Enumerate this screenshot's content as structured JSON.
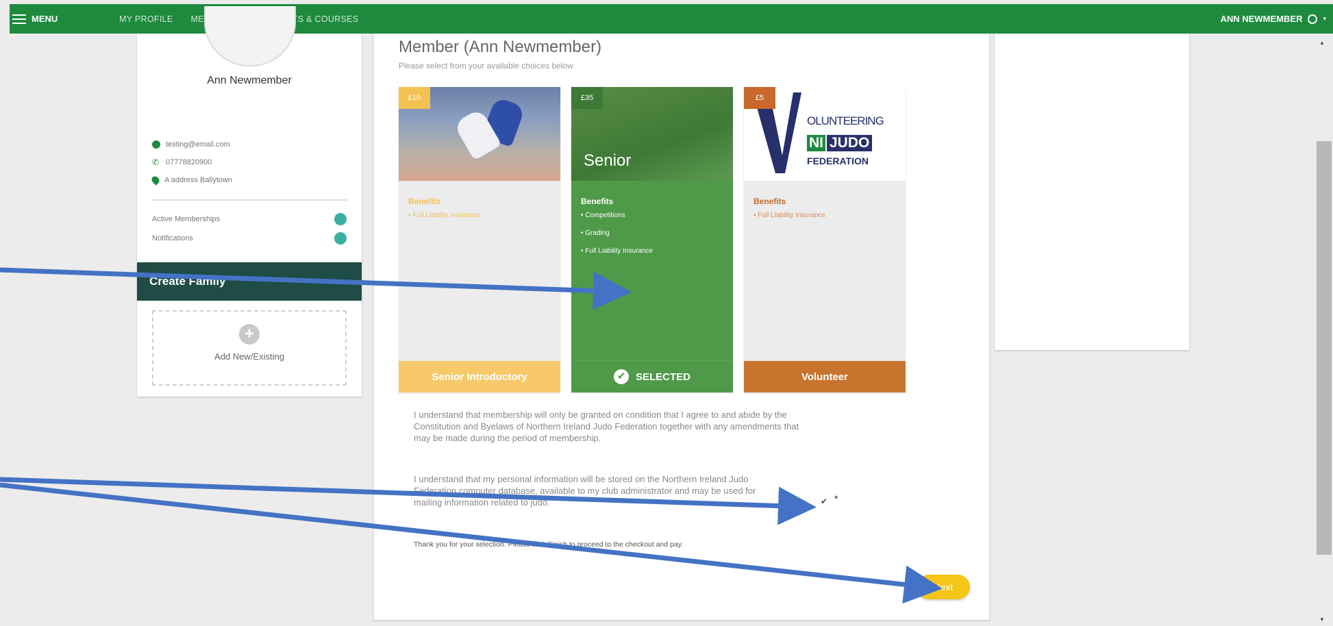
{
  "nav": {
    "menu_label": "MENU",
    "links": [
      "MY PROFILE",
      "MEMBERSHIP",
      "EVENTS & COURSES"
    ],
    "user_label": "ANN NEWMEMBER"
  },
  "profile": {
    "name": "Ann Newmember",
    "email": "testing@email.com",
    "phone": "07778820900",
    "address": "A address Ballytown",
    "stats": [
      {
        "label": "Active Memberships"
      },
      {
        "label": "Notifications"
      }
    ],
    "create_family_label": "Create Family",
    "add_label": "Add New/Existing"
  },
  "main": {
    "title": "Member (Ann Newmember)",
    "subtitle": "Please select from your available choices below",
    "cards": [
      {
        "price": "£10",
        "benefits_title": "Benefits",
        "benefits": [
          "Full Liability Insurance"
        ],
        "footer_label": "Senior Introductory"
      },
      {
        "price": "£35",
        "title": "Senior",
        "benefits_title": "Benefits",
        "benefits": [
          "Competitions",
          "Grading",
          "Full Liability Insurance"
        ],
        "footer_label": "SELECTED"
      },
      {
        "price": "£5",
        "logo": {
          "line1": "OLUNTEERING",
          "ni": "NI",
          "judo": "JUDO",
          "fed": "FEDERATION"
        },
        "benefits_title": "Benefits",
        "benefits": [
          "Full Liability Insurance"
        ],
        "footer_label": "Volunteer"
      }
    ],
    "terms1": "I understand that membership will only be granted on condition that I agree to and abide by the Constitution and Byelaws of Northern Ireland Judo Federation together with any amendments that may be made during the period of membership.",
    "terms2": "I understand that my personal information will be stored on the Northern Ireland Judo Federation computer database, available to my club administrator and may be used for mailing information related to judo.",
    "checkbox_mark": "✔",
    "required_mark": "*",
    "thanks": "Thank you for your selection. Please click Finish to proceed to the checkout and pay.",
    "next_label": "Next"
  },
  "colors": {
    "nav_green": "#1e8a3e",
    "selected_green": "#4e9a49",
    "intro_yellow": "#f7c96a",
    "volunteer_orange": "#c8742e",
    "family_dark": "#1f4c45",
    "next_yellow": "#f5c518",
    "arrow_blue": "#4472c4"
  }
}
